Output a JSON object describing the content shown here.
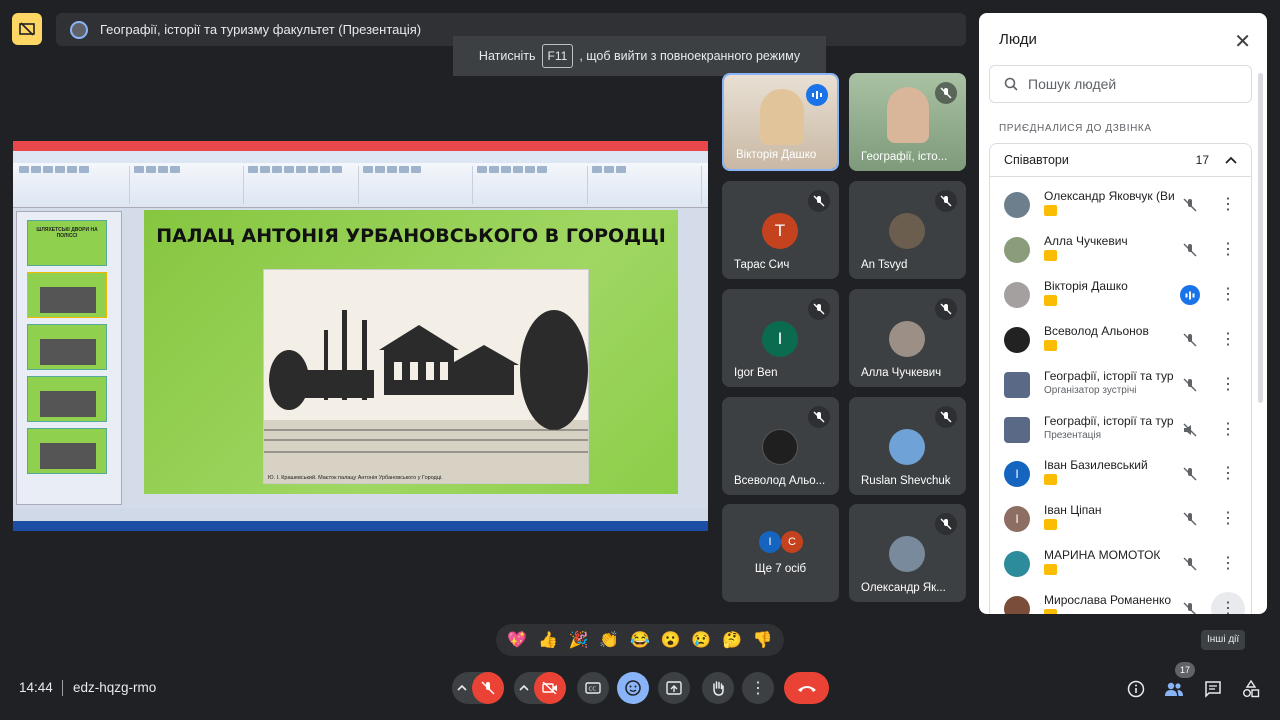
{
  "meeting": {
    "title": "Географії, історії та туризму факультет (Презентація)",
    "time": "14:44",
    "code": "edz-hqzg-rmo"
  },
  "toast": {
    "prefix": "Натисніть",
    "key": "F11",
    "suffix": ", щоб вийти з повноекранного режиму"
  },
  "slide": {
    "title": "ПАЛАЦ АНТОНІЯ УРБАНОВСЬКОГО В ГОРОДЦІ",
    "caption": "Ю. І. Крашевський. Маєток палацу Антонія Урбановського у Городці.",
    "thumb_title": "ШЛЯХЕТСЬКІ ДВОРИ НА ПОЛІССІ"
  },
  "tiles": [
    {
      "name": "Вікторія Дашко",
      "initial": "",
      "color": "#b7a28c",
      "talking": true
    },
    {
      "name": "Географії, істо...",
      "initial": "",
      "color": "#8fa38c",
      "talking": false
    },
    {
      "name": "Тарас Сич",
      "initial": "Т",
      "color": "#c5421e",
      "talking": false
    },
    {
      "name": "An Tsvyd",
      "initial": "",
      "color": "#6b5e4f",
      "talking": false
    },
    {
      "name": "Igor Ben",
      "initial": "I",
      "color": "#0b6b50",
      "talking": false
    },
    {
      "name": "Алла Чучкевич",
      "initial": "",
      "color": "#9b8f86",
      "talking": false
    },
    {
      "name": "Всеволод Альо...",
      "initial": "",
      "color": "#1f1f1f",
      "talking": false
    },
    {
      "name": "Ruslan Shevchuk",
      "initial": "",
      "color": "#6fa3d8",
      "talking": false
    },
    {
      "name": "Ще 7 осіб",
      "initial": "",
      "color": "",
      "talking": false
    },
    {
      "name": "Олександр Як...",
      "initial": "",
      "color": "#788a9c",
      "talking": false
    }
  ],
  "people_panel": {
    "title": "Люди",
    "search_placeholder": "Пошук людей",
    "section": "ПРИЄДНАЛИСЯ ДО ДЗВІНКА",
    "group_label": "Співавтори",
    "group_count": "17",
    "participants": [
      {
        "name": "Олександр Яковчук (Ви)",
        "sub": "",
        "initial": "",
        "color": "#6d7f8c",
        "talking": false,
        "badge": true
      },
      {
        "name": "Алла Чучкевич",
        "sub": "",
        "initial": "",
        "color": "#8a9c7a",
        "talking": false,
        "badge": true
      },
      {
        "name": "Вікторія Дашко",
        "sub": "",
        "initial": "",
        "color": "#a4a0a0",
        "talking": true,
        "badge": true
      },
      {
        "name": "Всеволод Альонов",
        "sub": "",
        "initial": "",
        "color": "#222222",
        "talking": false,
        "badge": true
      },
      {
        "name": "Географії, історії та тур...",
        "sub": "Організатор зустрічі",
        "initial": "",
        "color": "#5a6a86",
        "talking": false,
        "badge": false
      },
      {
        "name": "Географії, історії та тур...",
        "sub": "Презентація",
        "initial": "",
        "color": "#5a6a86",
        "talking": false,
        "badge": false
      },
      {
        "name": "Іван Базилевський",
        "sub": "",
        "initial": "І",
        "color": "#1565c0",
        "talking": false,
        "badge": true
      },
      {
        "name": "Іван Ціпан",
        "sub": "",
        "initial": "І",
        "color": "#8d6e63",
        "talking": false,
        "badge": true
      },
      {
        "name": "МАРИНА МОМОТОК",
        "sub": "",
        "initial": "",
        "color": "#2c8c9c",
        "talking": false,
        "badge": true
      },
      {
        "name": "Мирослава Романенко",
        "sub": "",
        "initial": "",
        "color": "#7a4d3a",
        "talking": false,
        "badge": true
      }
    ]
  },
  "tooltip": "Інші дії",
  "people_count_badge": "17",
  "reactions": [
    "💖",
    "👍",
    "🎉",
    "👏",
    "😂",
    "😮",
    "😢",
    "🤔",
    "👎"
  ]
}
